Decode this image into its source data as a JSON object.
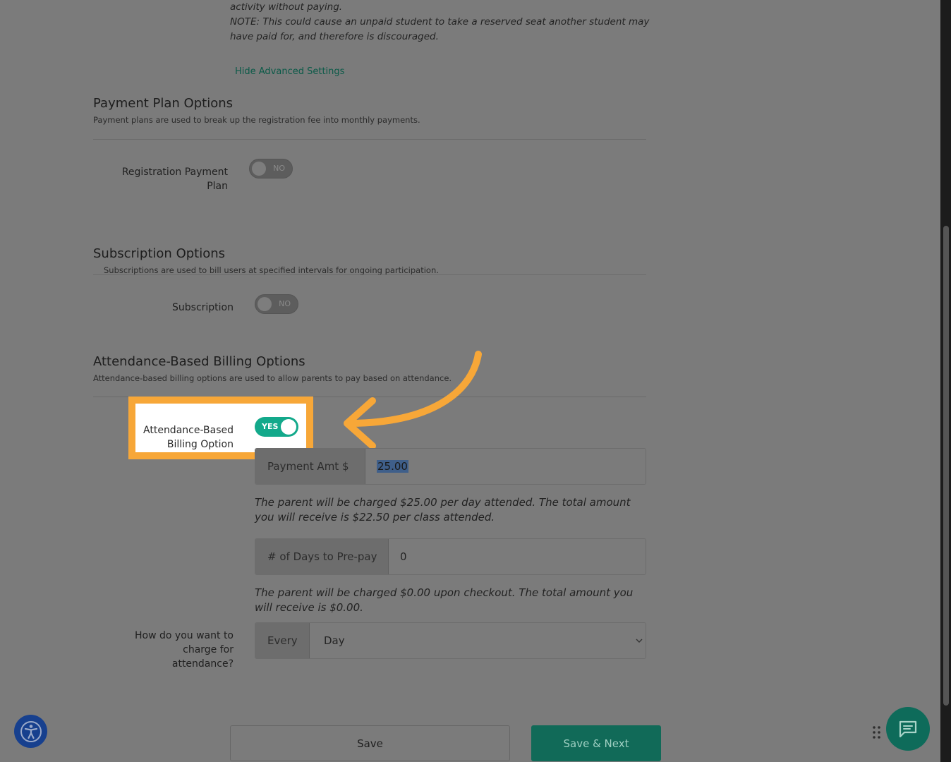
{
  "advanced": {
    "note_lines": [
      "activity without paying.",
      "NOTE: This could cause an unpaid student to take a reserved seat another student may",
      "have paid for, and therefore is discouraged."
    ],
    "hide_link": "Hide Advanced Settings"
  },
  "payment_plan": {
    "title": "Payment Plan Options",
    "description": "Payment plans are used to break up the registration fee into monthly payments.",
    "field_label_1": "Registration Payment",
    "field_label_2": "Plan",
    "toggle_text": "NO"
  },
  "subscription": {
    "title": "Subscription Options",
    "description": "Subscriptions are used to bill users at specified intervals for ongoing participation.",
    "field_label": "Subscription",
    "toggle_text": "NO"
  },
  "attendance": {
    "title": "Attendance-Based Billing Options",
    "description": "Attendance-based billing options are used to allow parents to pay based on attendance.",
    "field_label_1": "Attendance-Based",
    "field_label_2": "Billing Option",
    "toggle_text": "YES",
    "payment_amt_label": "Payment Amt $",
    "payment_amt_value": "25.00",
    "payment_helper_1": "The parent will be charged $25.00 per day attended. The total amount",
    "payment_helper_2": "you will receive is $22.50 per class attended.",
    "prepay_label": "# of Days to Pre-pay",
    "prepay_value": "0",
    "prepay_helper_1": "The parent will be charged $0.00 upon checkout. The total amount you",
    "prepay_helper_2": "will receive is $0.00.",
    "charge_label_1": "How do you want to",
    "charge_label_2": "charge for",
    "charge_label_3": "attendance?",
    "every_label": "Every",
    "frequency_selected": "Day"
  },
  "buttons": {
    "save": "Save",
    "save_next": "Save & Next"
  },
  "colors": {
    "accent_green": "#13a98b",
    "highlight_orange": "#f7a738",
    "accessibility_blue": "#17408e"
  }
}
